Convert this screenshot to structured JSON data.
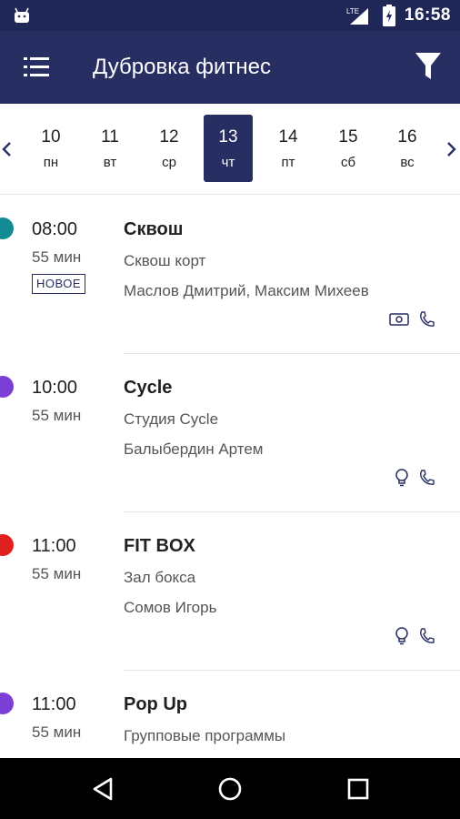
{
  "status_bar": {
    "time": "16:58",
    "network": "LTE"
  },
  "app_bar": {
    "title": "Дубровка фитнес"
  },
  "dates": [
    {
      "num": "10",
      "weekday": "пн",
      "active": false
    },
    {
      "num": "11",
      "weekday": "вт",
      "active": false
    },
    {
      "num": "12",
      "weekday": "ср",
      "active": false
    },
    {
      "num": "13",
      "weekday": "чт",
      "active": true
    },
    {
      "num": "14",
      "weekday": "пт",
      "active": false
    },
    {
      "num": "15",
      "weekday": "сб",
      "active": false
    },
    {
      "num": "16",
      "weekday": "вс",
      "active": false
    }
  ],
  "classes": [
    {
      "time": "08:00",
      "duration": "55 мин",
      "badge": "НОВОЕ",
      "name": "Сквош",
      "place": "Сквош корт",
      "trainer": "Маслов Дмитрий, Максим Михеев",
      "color": "#138b92",
      "icons": [
        "cash-icon",
        "phone-icon"
      ]
    },
    {
      "time": "10:00",
      "duration": "55 мин",
      "badge": "",
      "name": "Cycle",
      "place": "Студия Cycle",
      "trainer": "Балыбердин Артем",
      "color": "#7b3fd6",
      "icons": [
        "lightbulb-icon",
        "phone-icon"
      ]
    },
    {
      "time": "11:00",
      "duration": "55 мин",
      "badge": "",
      "name": "FIT BOX",
      "place": "Зал бокса",
      "trainer": "Сомов Игорь",
      "color": "#e0201e",
      "icons": [
        "lightbulb-icon",
        "phone-icon"
      ]
    },
    {
      "time": "11:00",
      "duration": "55 мин",
      "badge": "",
      "name": "Pop Up",
      "place": "Групповые программы",
      "trainer": "",
      "color": "#7b3fd6",
      "icons": []
    }
  ],
  "colors": {
    "primary": "#262e62",
    "status_bar": "#1f2756"
  }
}
